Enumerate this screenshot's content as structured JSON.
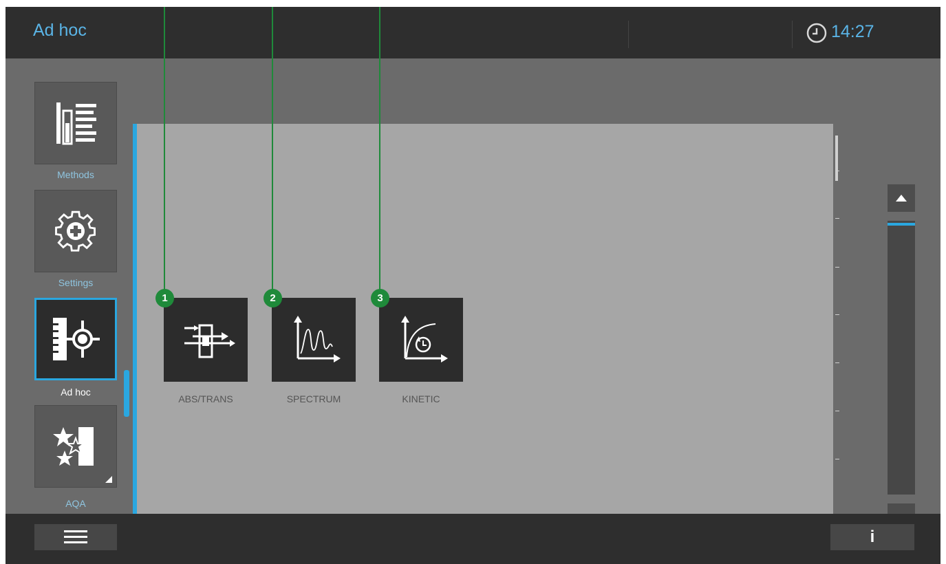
{
  "header": {
    "title": "Ad hoc",
    "time": "14:27",
    "clock_icon": "clock-icon"
  },
  "nav": {
    "items": [
      {
        "label": "Methods",
        "icon": "methods-list-icon"
      },
      {
        "label": "Settings",
        "icon": "gear-plus-icon"
      },
      {
        "label": "Ad hoc",
        "icon": "ad-hoc-crosshair-icon",
        "active": true
      },
      {
        "label": "AQA",
        "icon": "stars-icon"
      }
    ]
  },
  "tiles": [
    {
      "label": "ABS/TRANS",
      "badge": "1",
      "icon": "abs-trans-icon"
    },
    {
      "label": "SPECTRUM",
      "badge": "2",
      "icon": "spectrum-icon"
    },
    {
      "label": "KINETIC",
      "badge": "3",
      "icon": "kinetic-icon"
    }
  ],
  "footer": {
    "menu_icon": "hamburger-menu-icon",
    "info_label": "i"
  },
  "colors": {
    "accent": "#2aa7e0",
    "callout": "#1f8a3a",
    "header_bg": "#2e2e2e",
    "panel_bg": "#a6a6a6"
  }
}
